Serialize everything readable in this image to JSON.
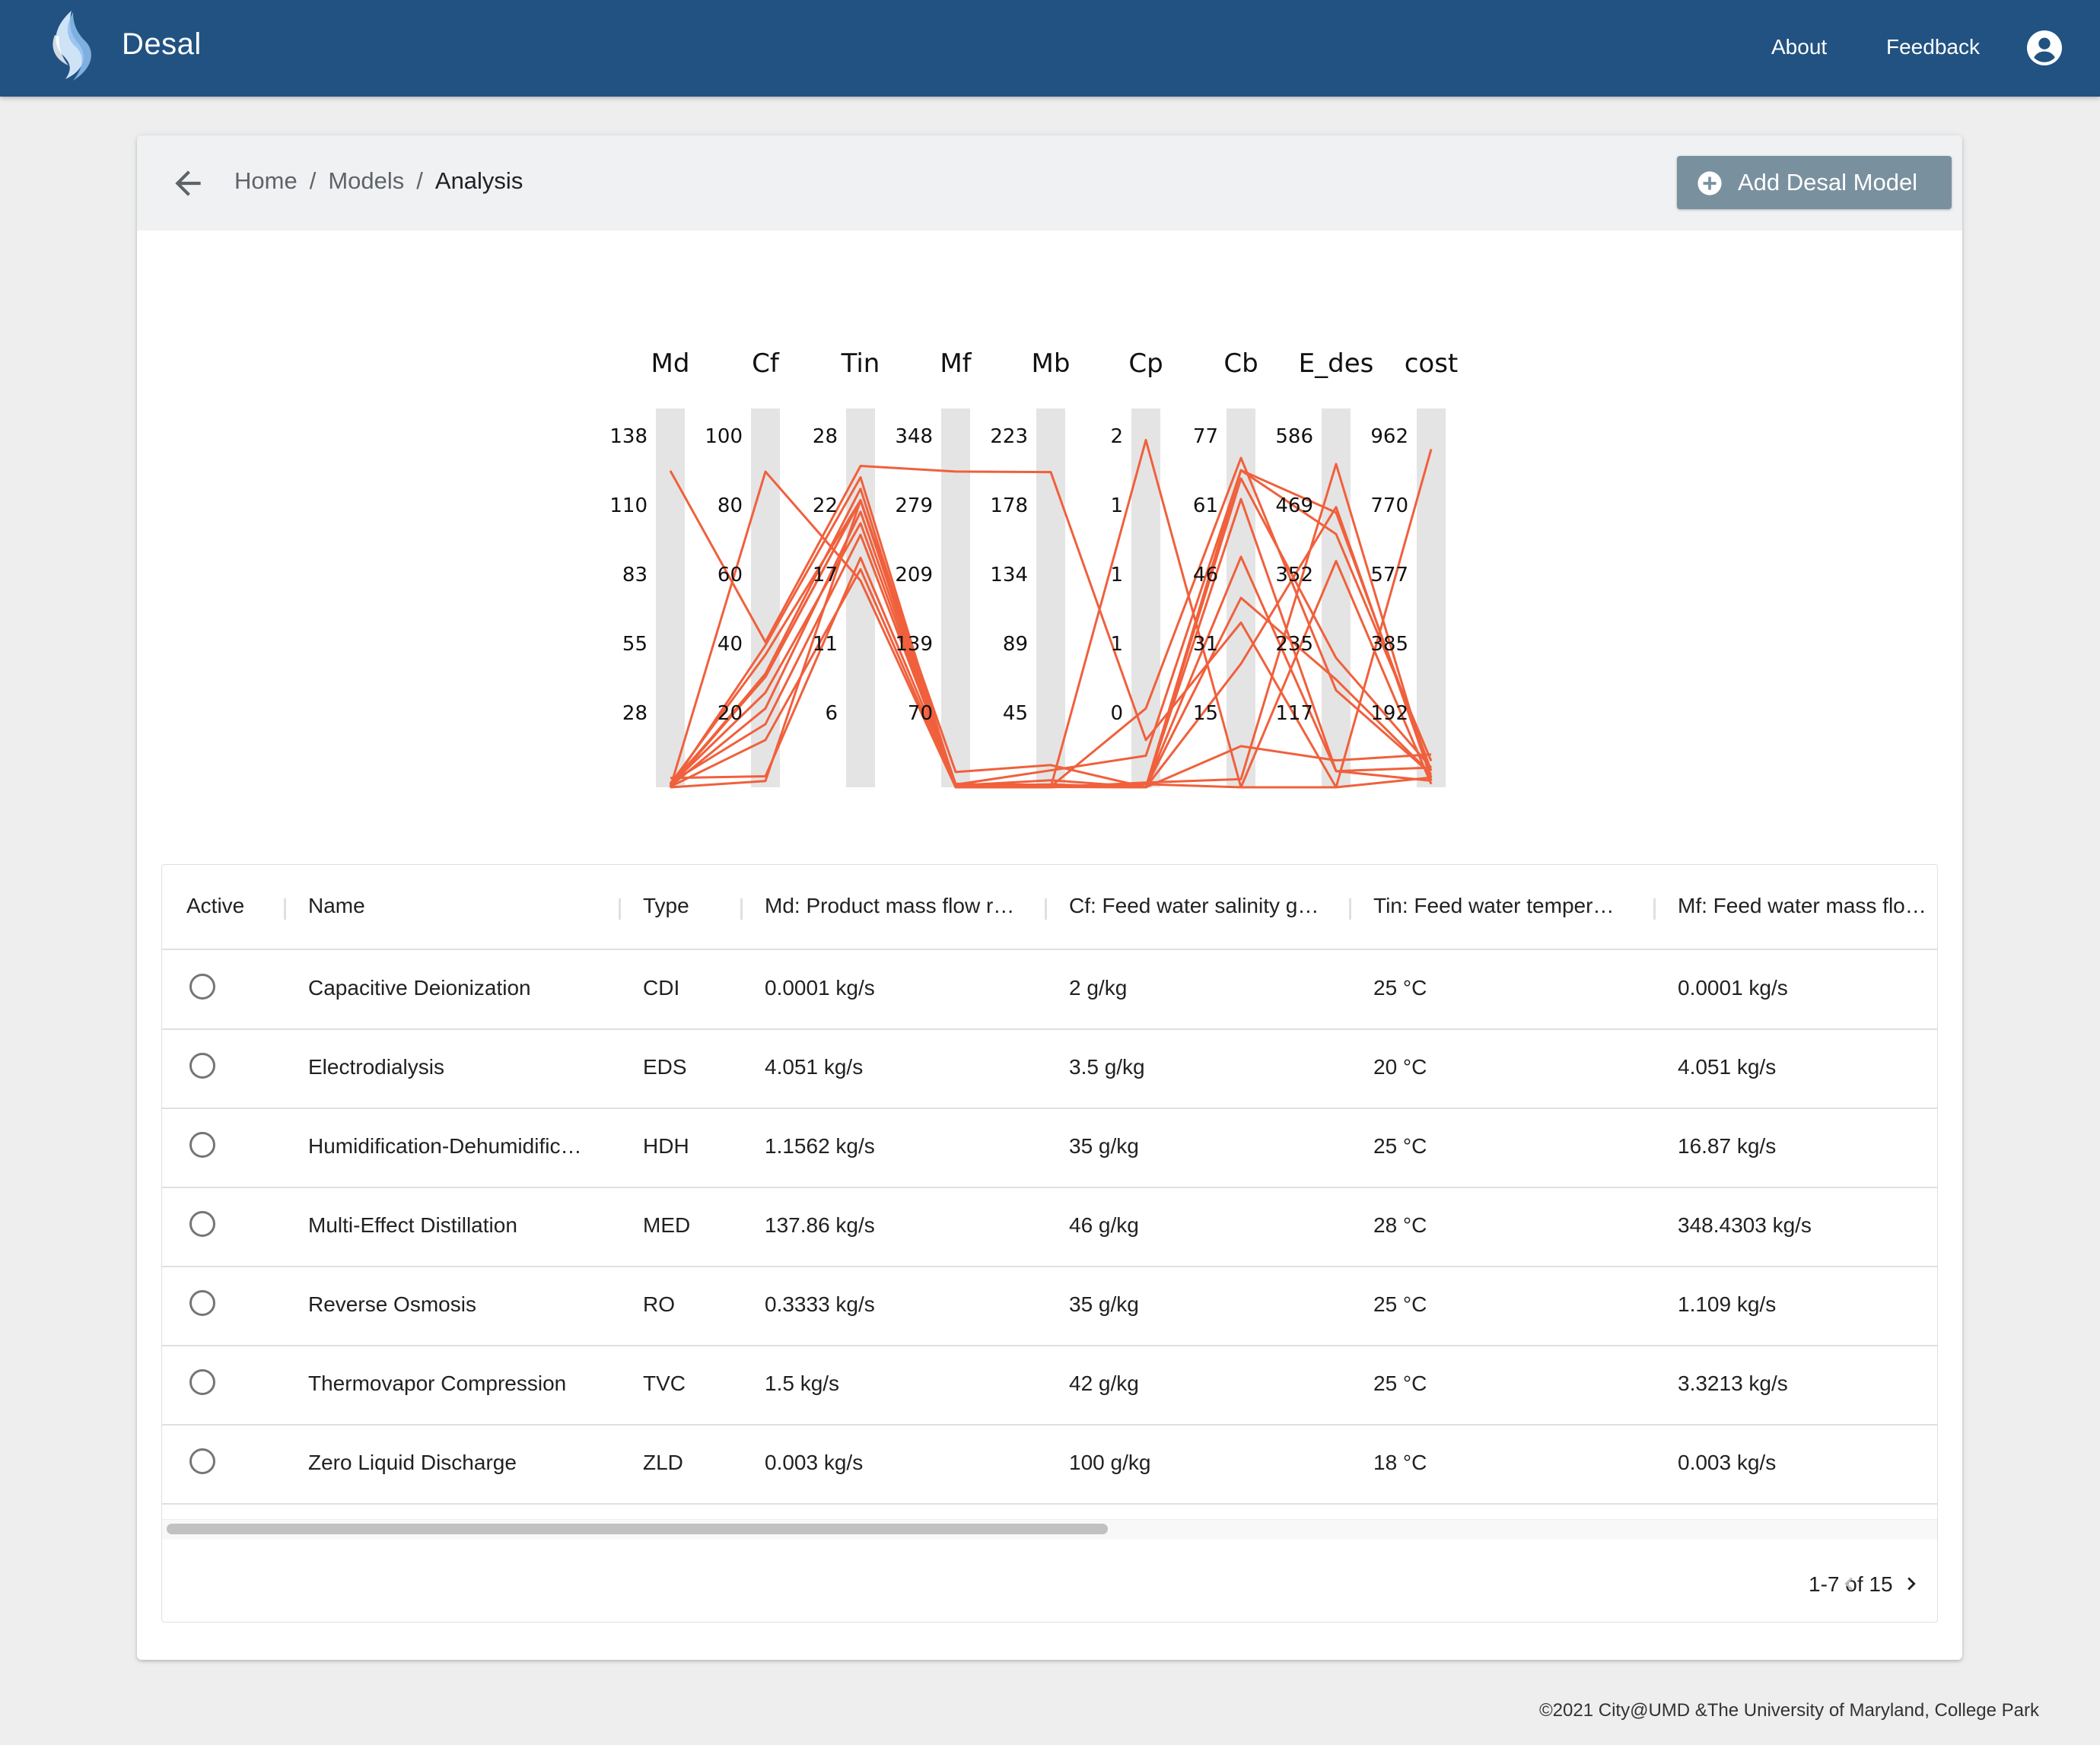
{
  "app": {
    "title": "Desal",
    "nav": {
      "about": "About",
      "feedback": "Feedback"
    }
  },
  "breadcrumb": {
    "home": "Home",
    "models": "Models",
    "current": "Analysis",
    "separator": "/"
  },
  "header": {
    "add_button_label": "Add Desal Model"
  },
  "chart_data": {
    "type": "parallel-coordinates",
    "line_color": "#f0603c",
    "axes": [
      {
        "name": "Md",
        "ticks": [
          "138",
          "110",
          "83",
          "55",
          "28"
        ],
        "range": [
          0,
          165
        ]
      },
      {
        "name": "Cf",
        "ticks": [
          "100",
          "80",
          "60",
          "40",
          "20"
        ],
        "range": [
          0,
          120
        ]
      },
      {
        "name": "Tin",
        "ticks": [
          "28",
          "22",
          "17",
          "11",
          "6"
        ],
        "range": [
          0,
          33
        ]
      },
      {
        "name": "Mf",
        "ticks": [
          "348",
          "279",
          "209",
          "139",
          "70"
        ],
        "range": [
          0,
          418
        ]
      },
      {
        "name": "Mb",
        "ticks": [
          "223",
          "178",
          "134",
          "89",
          "45"
        ],
        "range": [
          0,
          268
        ]
      },
      {
        "name": "Cp",
        "ticks": [
          "2",
          "1",
          "1",
          "1",
          "0"
        ],
        "range": [
          0,
          2.4
        ]
      },
      {
        "name": "Cb",
        "ticks": [
          "77",
          "61",
          "46",
          "31",
          "15"
        ],
        "range": [
          0,
          92
        ]
      },
      {
        "name": "E_des",
        "ticks": [
          "586",
          "469",
          "352",
          "235",
          "117"
        ],
        "range": [
          0,
          703
        ]
      },
      {
        "name": "cost",
        "ticks": [
          "962",
          "770",
          "577",
          "385",
          "192"
        ],
        "range": [
          0,
          1154
        ]
      }
    ],
    "lines": [
      {
        "values": [
          0.0001,
          2,
          25,
          0.0001,
          0.0001,
          0.03,
          2,
          600,
          20
        ]
      },
      {
        "values": [
          4.051,
          3.5,
          20,
          4.051,
          0.5,
          0.5,
          80,
          180,
          40
        ]
      },
      {
        "values": [
          1.1562,
          35,
          25,
          16.87,
          15.7,
          0.0,
          56,
          30,
          60
        ]
      },
      {
        "values": [
          137.86,
          46,
          28,
          348.43,
          223,
          0.3,
          40,
          0,
          30
        ]
      },
      {
        "values": [
          0.3333,
          35,
          25,
          1.109,
          0.78,
          0.02,
          0,
          420,
          10
        ]
      },
      {
        "values": [
          1.5,
          42,
          25,
          3.3213,
          1.82,
          0.0,
          77,
          510,
          50
        ]
      },
      {
        "values": [
          0.003,
          100,
          18,
          0.003,
          0.001,
          2.2,
          0,
          0,
          1030
        ]
      },
      {
        "values": [
          2.0,
          20,
          22,
          3.0,
          12,
          0.2,
          77,
          470,
          80
        ]
      },
      {
        "values": [
          1.0,
          30,
          23,
          2.0,
          5,
          0.0,
          70,
          30,
          20
        ]
      },
      {
        "values": [
          0.5,
          25,
          24,
          1.0,
          2,
          0.0,
          46,
          200,
          40
        ]
      },
      {
        "values": [
          0.2,
          45,
          27,
          0.5,
          1,
          0.0,
          75,
          240,
          60
        ]
      },
      {
        "values": [
          0.1,
          36,
          26,
          0.3,
          0.5,
          0.0,
          10,
          50,
          100
        ]
      },
      {
        "values": [
          0.3,
          15,
          19,
          0.4,
          0.2,
          0.0,
          30,
          520,
          30
        ]
      }
    ]
  },
  "table": {
    "columns": [
      {
        "label": "Active"
      },
      {
        "label": "Name"
      },
      {
        "label": "Type"
      },
      {
        "label": "Md: Product mass flow r…"
      },
      {
        "label": "Cf: Feed water salinity g…"
      },
      {
        "label": "Tin: Feed water temper…"
      },
      {
        "label": "Mf: Feed water mass flo…"
      }
    ],
    "rows": [
      {
        "name": "Capacitive Deionization",
        "type": "CDI",
        "md": "0.0001 kg/s",
        "cf": "2 g/kg",
        "tin": "25 °C",
        "mf": "0.0001 kg/s"
      },
      {
        "name": "Electrodialysis",
        "type": "EDS",
        "md": "4.051 kg/s",
        "cf": "3.5 g/kg",
        "tin": "20 °C",
        "mf": "4.051 kg/s"
      },
      {
        "name": "Humidification-Dehumidific…",
        "type": "HDH",
        "md": "1.1562 kg/s",
        "cf": "35 g/kg",
        "tin": "25 °C",
        "mf": "16.87 kg/s"
      },
      {
        "name": "Multi-Effect Distillation",
        "type": "MED",
        "md": "137.86 kg/s",
        "cf": "46 g/kg",
        "tin": "28 °C",
        "mf": "348.4303 kg/s"
      },
      {
        "name": "Reverse Osmosis",
        "type": "RO",
        "md": "0.3333 kg/s",
        "cf": "35 g/kg",
        "tin": "25 °C",
        "mf": "1.109 kg/s"
      },
      {
        "name": "Thermovapor Compression",
        "type": "TVC",
        "md": "1.5 kg/s",
        "cf": "42 g/kg",
        "tin": "25 °C",
        "mf": "3.3213 kg/s"
      },
      {
        "name": "Zero Liquid Discharge",
        "type": "ZLD",
        "md": "0.003 kg/s",
        "cf": "100 g/kg",
        "tin": "18 °C",
        "mf": "0.003 kg/s"
      }
    ],
    "pagination": {
      "range_text": "1-7 of 15"
    }
  },
  "footer": {
    "text": "©2021 City@UMD &The University of Maryland, College Park"
  },
  "colors": {
    "appbar": "#215282",
    "add_button": "#79909f",
    "chart_line": "#f0603c"
  }
}
